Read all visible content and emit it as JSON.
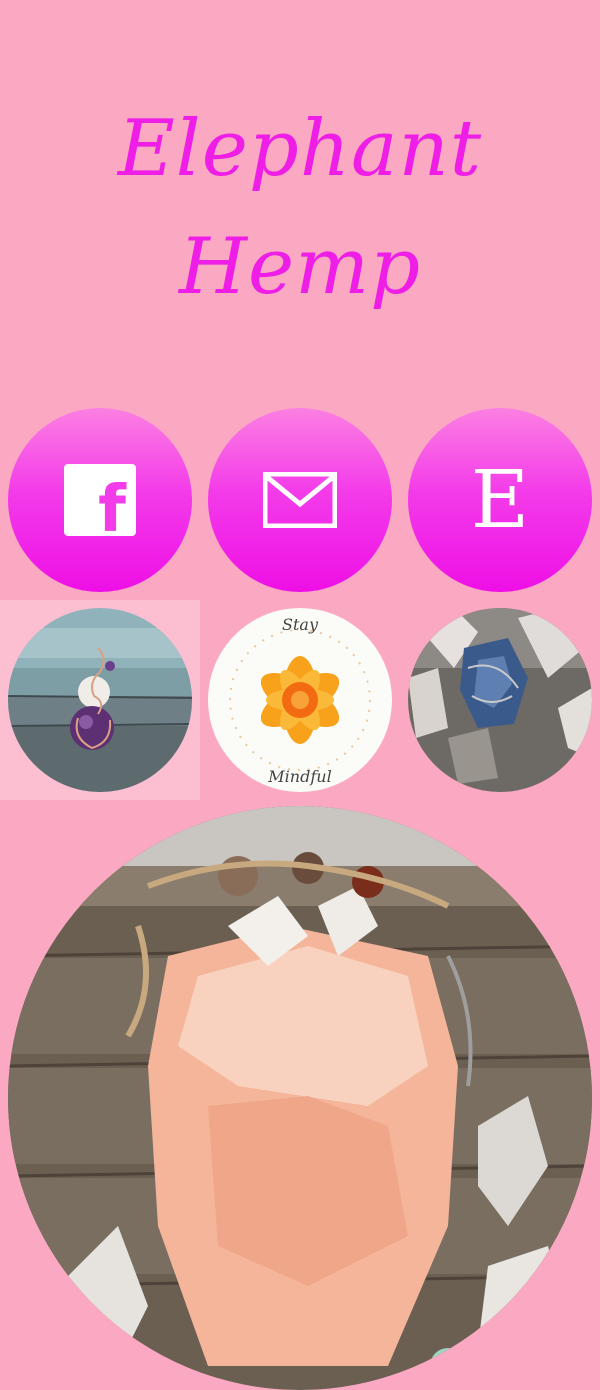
{
  "title": {
    "line1": "Elephant",
    "line2": "Hemp"
  },
  "social": [
    {
      "name": "facebook",
      "icon": "facebook-icon",
      "glyph": "f"
    },
    {
      "name": "email",
      "icon": "mail-icon"
    },
    {
      "name": "etsy",
      "icon": "etsy-icon",
      "glyph": "E"
    }
  ],
  "gallery": {
    "flower_card": {
      "top_text": "Stay",
      "bottom_text": "Mindful"
    }
  },
  "colors": {
    "background": "#fba9c2",
    "accent": "#ee1ee6"
  }
}
